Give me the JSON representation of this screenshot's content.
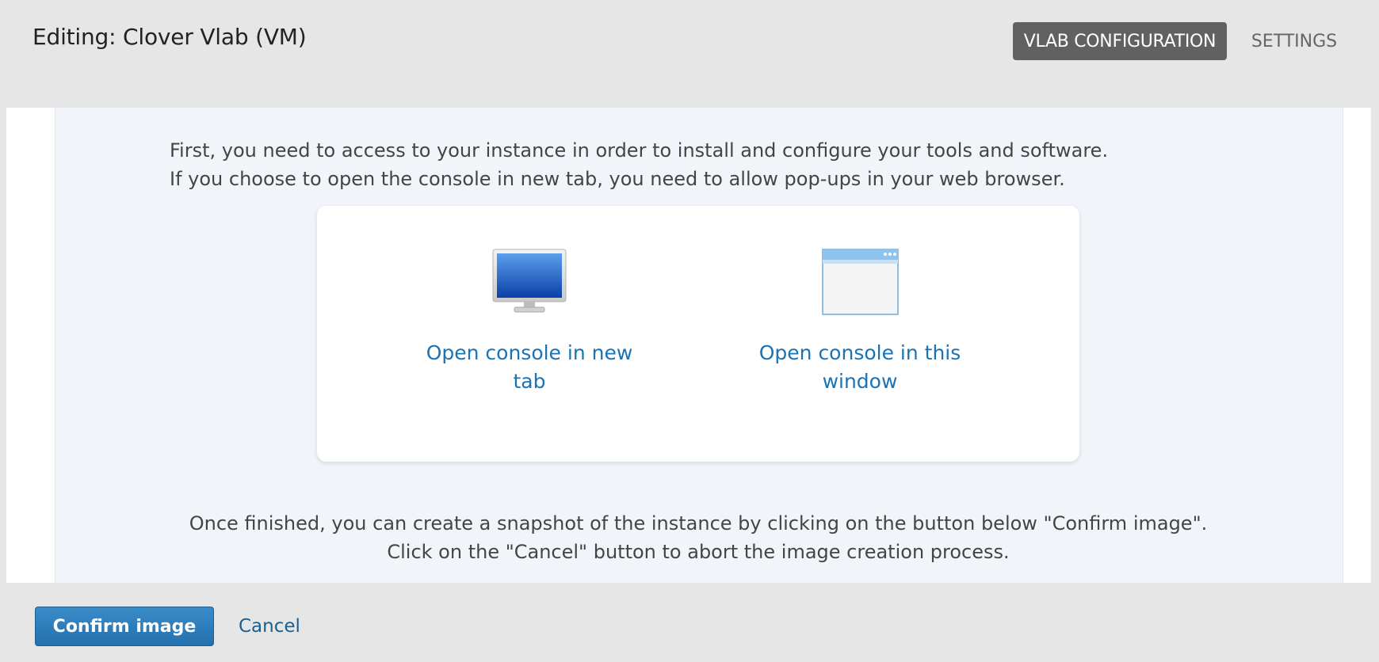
{
  "header": {
    "title": "Editing: Clover Vlab (VM)",
    "tabs": [
      {
        "label": "VLAB CONFIGURATION",
        "active": true
      },
      {
        "label": "SETTINGS",
        "active": false
      }
    ]
  },
  "main": {
    "intro_line_1": "First, you need to access to your instance in order to install and configure your tools and software.",
    "intro_line_2": "If you choose to open the console in new tab, you need to allow pop-ups in your web browser.",
    "options": [
      {
        "icon": "monitor-icon",
        "label_line_1": "Open console in new",
        "label_line_2": "tab"
      },
      {
        "icon": "browser-window-icon",
        "label_line_1": "Open console in this",
        "label_line_2": "window"
      }
    ],
    "outro_line_1": "Once finished, you can create a snapshot of the instance by clicking on the button below \"Confirm image\".",
    "outro_line_2": "Click on the \"Cancel\" button to abort the image creation process."
  },
  "footer": {
    "confirm_label": "Confirm image",
    "cancel_label": "Cancel"
  },
  "colors": {
    "accent": "#2370ae",
    "link": "#1a73b5",
    "tab_active_bg": "#616161",
    "panel_bg": "#f1f5fa"
  }
}
